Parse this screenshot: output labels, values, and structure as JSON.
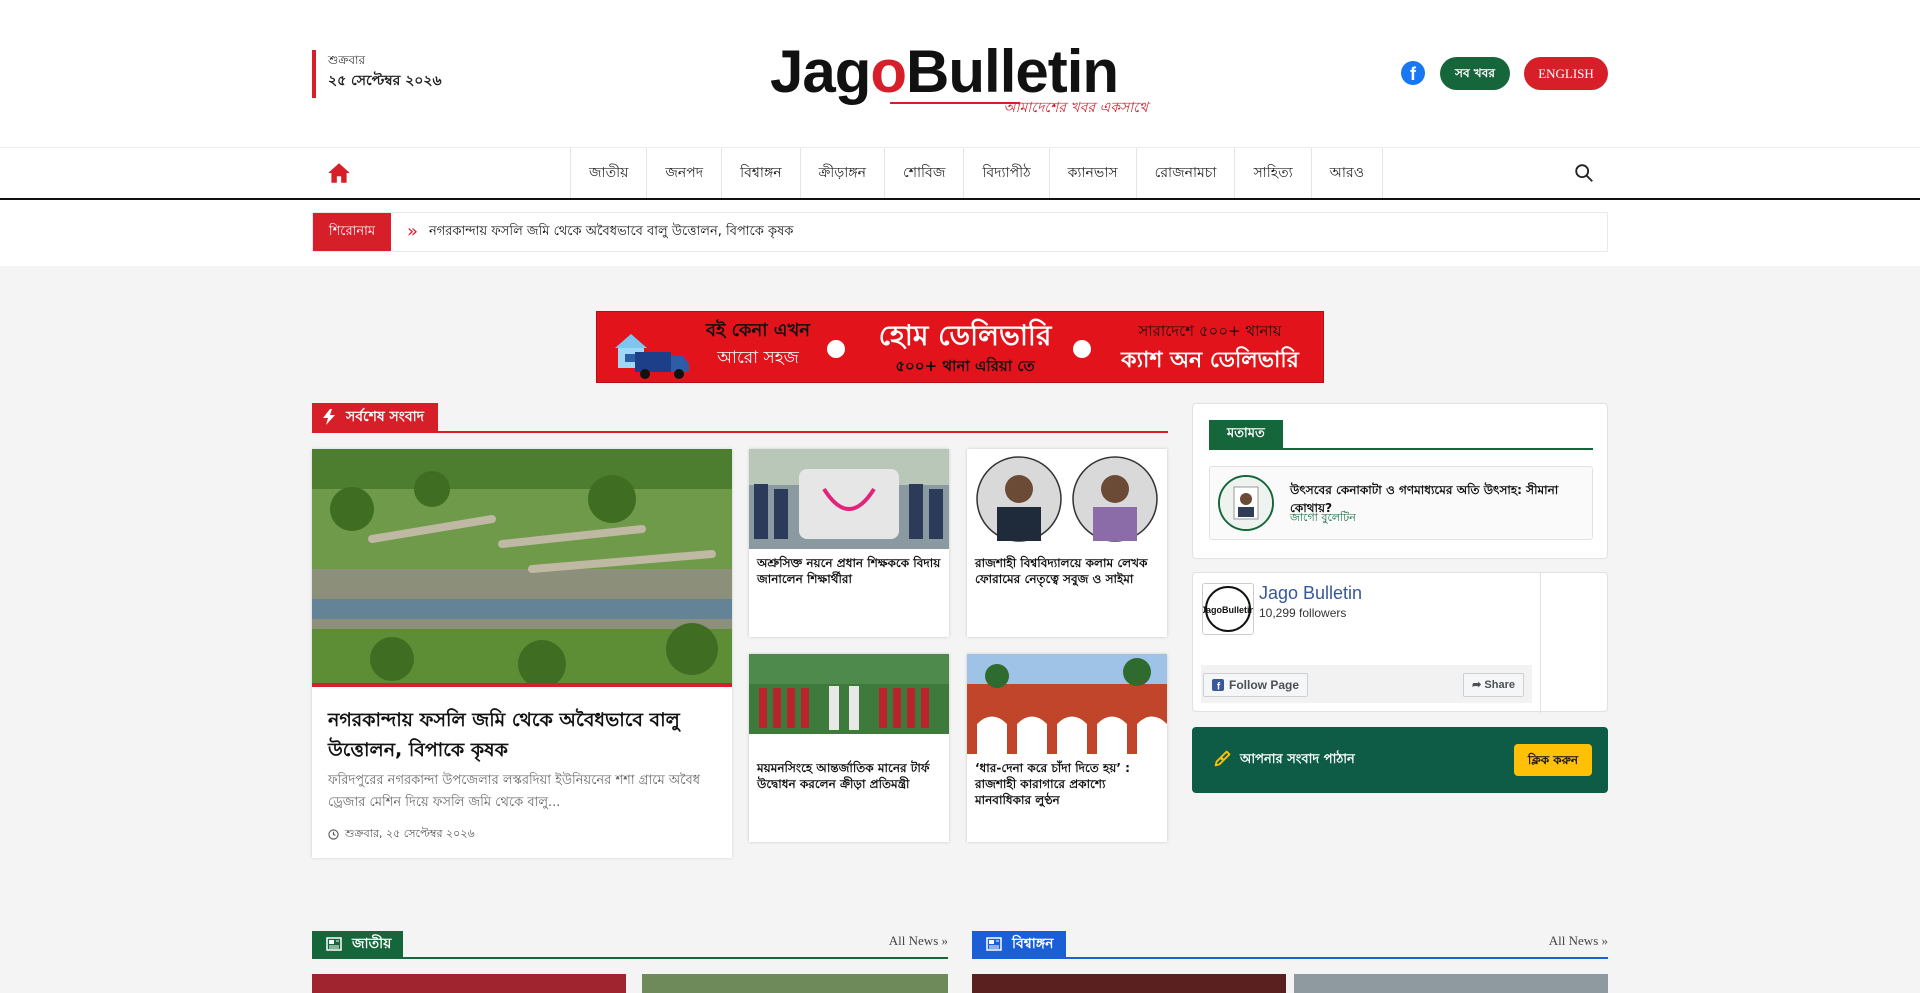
{
  "header": {
    "day": "শুক্রবার",
    "date": "২৫ সেপ্টেম্বর ২০২৬",
    "logo_text_1": "Jag",
    "logo_text_o": "o",
    "logo_text_2": "Bulletin",
    "logo_tagline": "আমাদেশের খবর একসাথে",
    "all_news_label": "সব খবর",
    "english_label": "ENGLISH"
  },
  "nav": {
    "items": [
      "জাতীয়",
      "জনপদ",
      "বিশ্বাঙ্গন",
      "ক্রীড়াঙ্গন",
      "শোবিজ",
      "বিদ্যাপীঠ",
      "ক্যানভাস",
      "রোজনামচা",
      "সাহিত্য",
      "আরও"
    ]
  },
  "ticker": {
    "label": "শিরোনাম",
    "text": "নগরকান্দায় ফসলি জমি থেকে অবৈধভাবে বালু উত্তোলন, বিপাকে কৃষক"
  },
  "ad": {
    "line1": "বই কেনা এখন",
    "line1b": "আরো সহজ",
    "line2": "হোম ডেলিভারি",
    "line2b": "৫০০+ থানা এরিয়া তে",
    "line3": "সারাদেশে ৫০০+ থানায়",
    "line3b": "ক্যাশ অন ডেলিভারি"
  },
  "latest": {
    "section_label": "সর্বশেষ সংবাদ",
    "lead": {
      "title": "নগরকান্দায় ফসলি জমি থেকে অবৈধভাবে বালু উত্তোলন, বিপাকে কৃষক",
      "summary": "ফরিদপুরের নগরকান্দা উপজেলার লস্করদিয়া ইউনিয়নের শশা গ্রামে অবৈধ ড্রেজার মেশিন দিয়ে ফসলি জমি থেকে বালু...",
      "date": "শুক্রবার, ২৫ সেপ্টেম্বর ২০২৬"
    },
    "cards": [
      {
        "title": "অশ্রুসিক্ত নয়নে প্রধান শিক্ষককে বিদায় জানালেন শিক্ষার্থীরা"
      },
      {
        "title": "রাজশাহী বিশ্ববিদ্যালয়ে কলাম লেখক ফোরামের নেতৃত্বে সবুজ ও সাইমা"
      },
      {
        "title": "ময়মনসিংহে আন্তর্জাতিক মানের টার্ফ উদ্বোধন করলেন ক্রীড়া প্রতিমন্ত্রী",
        "caption": "ময়মনসিংহে আন্তর্জাতিক মানের টার্ফ উদ্বোধন করলেন ক্রীড়া প্রতিমন্ত্রী"
      },
      {
        "title": "‘ধার-দেনা করে চাঁদা দিতে হয়’ : রাজশাহী কারাগারে প্রকাশ্যে মানবাধিকার লুণ্ঠন"
      }
    ]
  },
  "opinion": {
    "section_label": "মতামত",
    "title": "উৎসবের কেনাকাটা ও গণমাধ্যমের অতি উৎসাহ: সীমানা কোথায়?",
    "author": "জাগো বুলেটিন"
  },
  "facebook": {
    "page_name": "Jago Bulletin",
    "followers": "10,299 followers",
    "follow_label": "Follow Page",
    "share_label": "Share",
    "logo_text": "JagoBulletin"
  },
  "send_news": {
    "label": "আপনার সংবাদ পাঠান",
    "button": "ক্লিক করুন"
  },
  "bottom": {
    "left_label": "জাতীয়",
    "right_label": "বিশ্বাঙ্গন",
    "more_label": "All News"
  },
  "colors": {
    "brand_red": "#d71f2a",
    "brand_green": "#16663b",
    "brand_blue": "#1b5fd6",
    "send_bg": "#0e5c45"
  }
}
